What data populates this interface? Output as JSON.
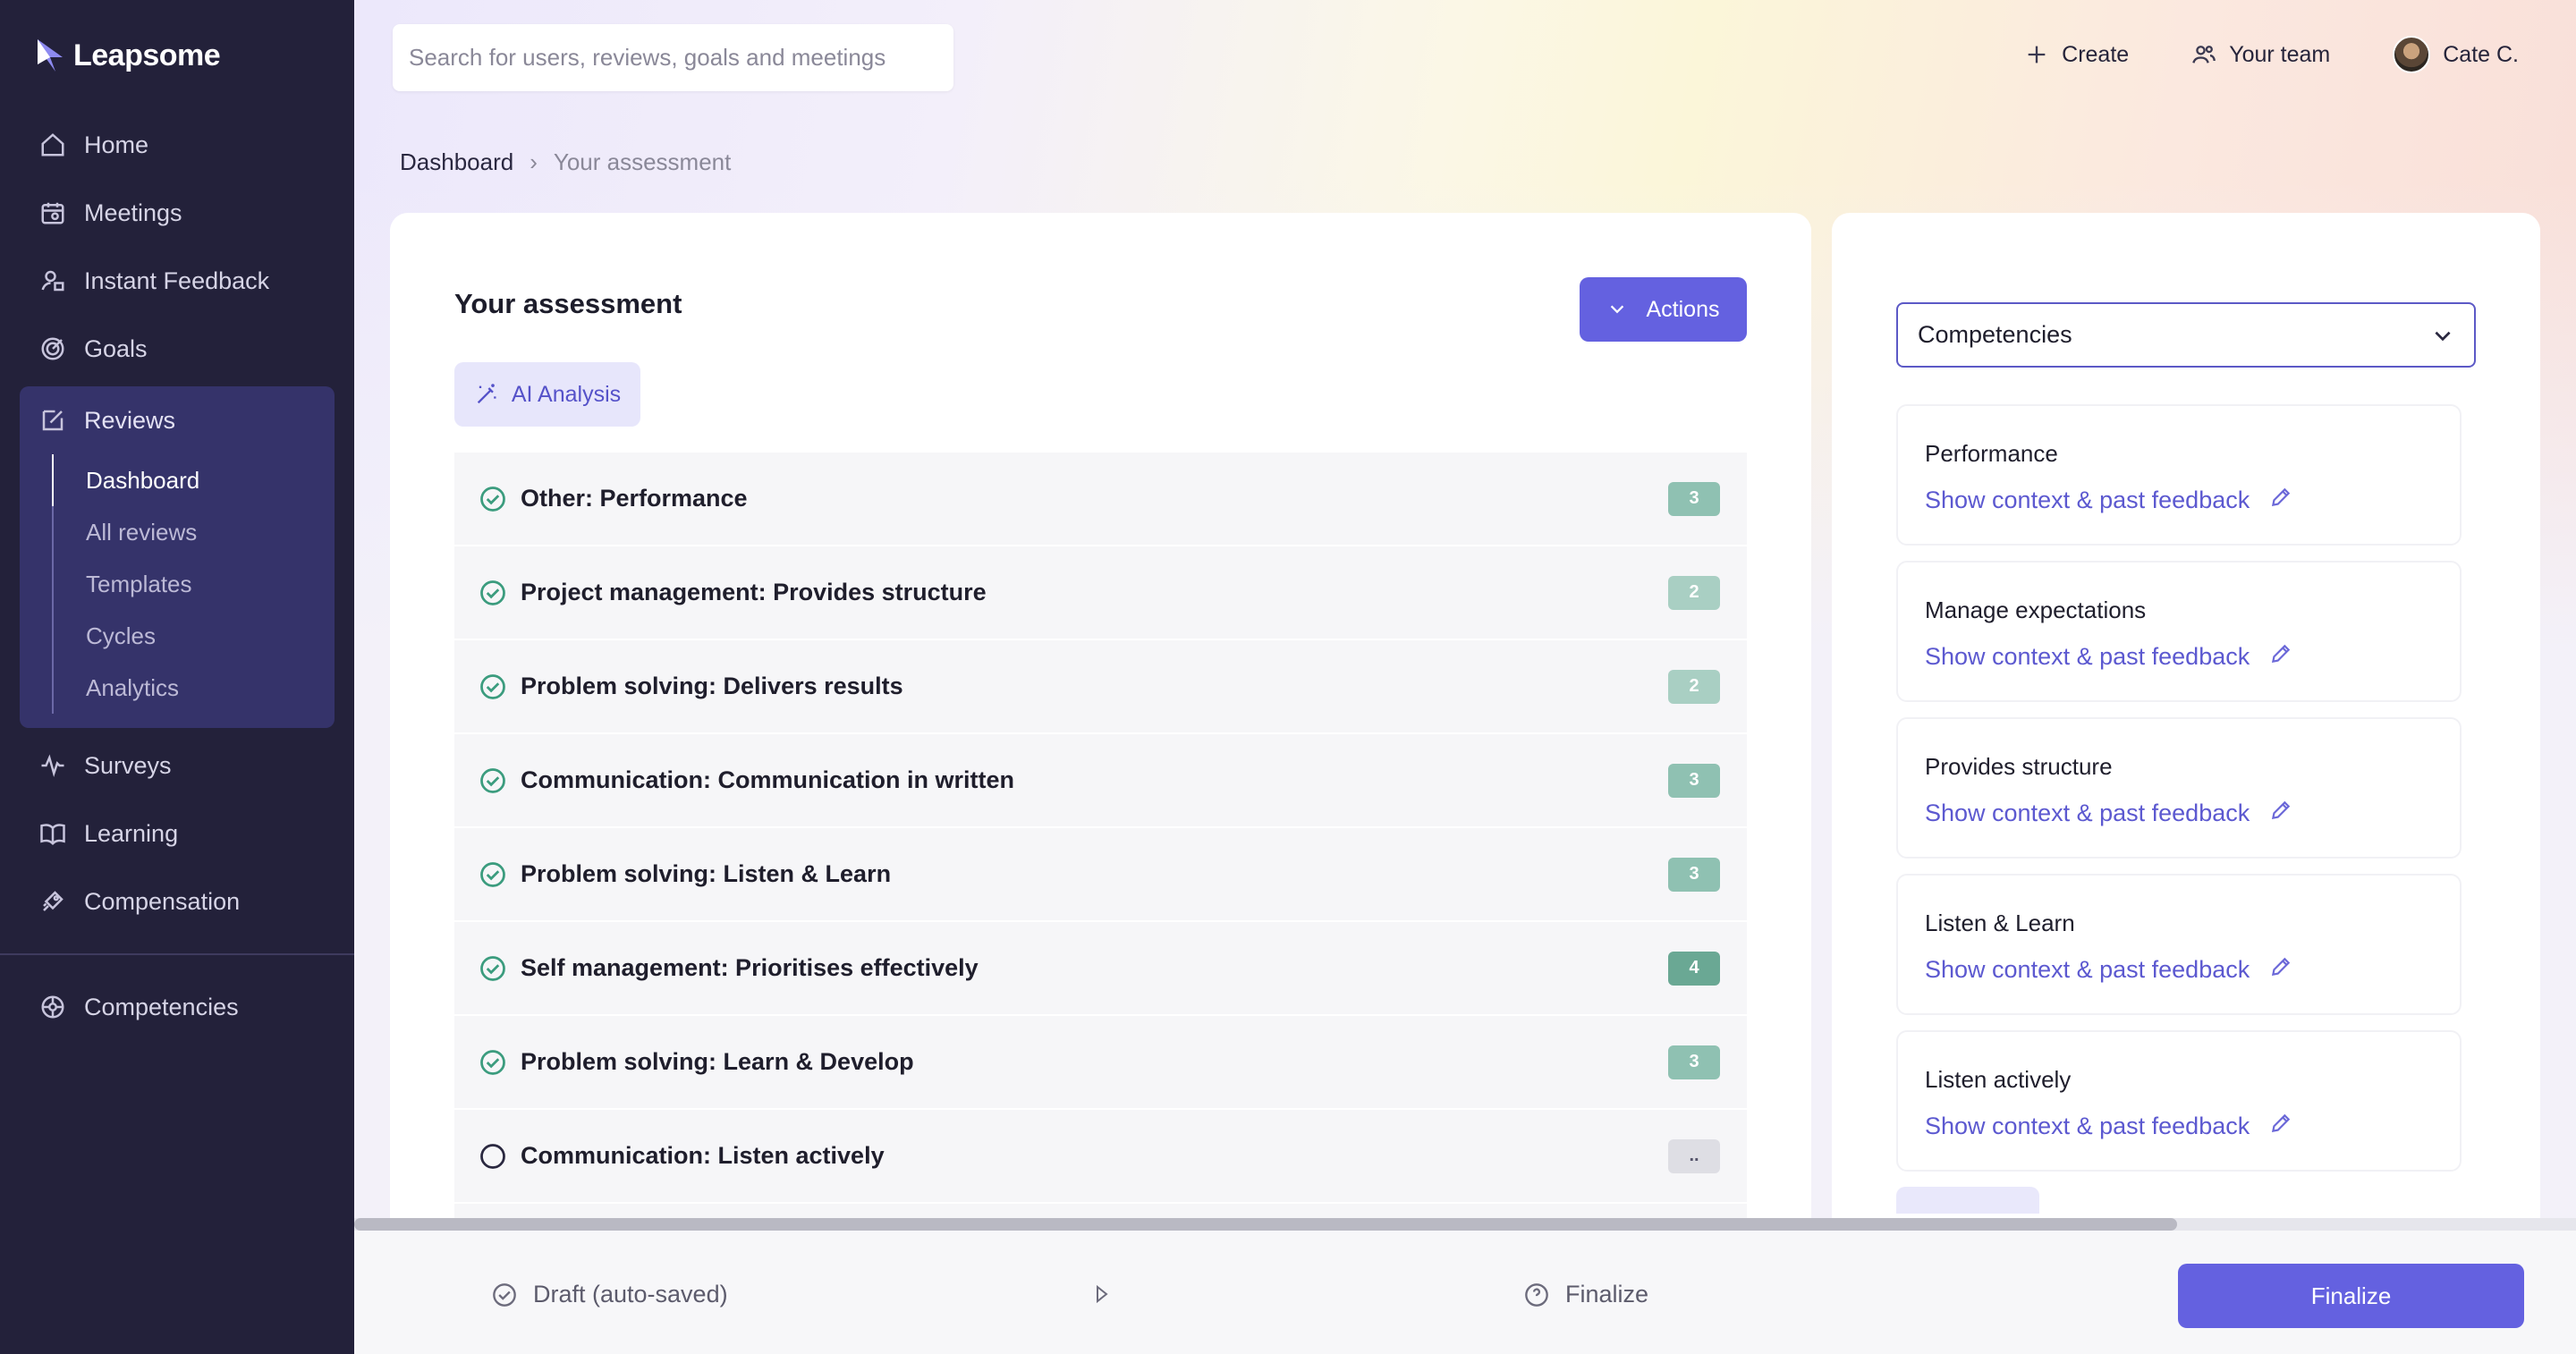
{
  "app": {
    "name": "Leapsome"
  },
  "sidebar": {
    "items": [
      {
        "label": "Home",
        "icon": "home-icon"
      },
      {
        "label": "Meetings",
        "icon": "meetings-icon"
      },
      {
        "label": "Instant Feedback",
        "icon": "feedback-icon"
      },
      {
        "label": "Goals",
        "icon": "goals-icon"
      }
    ],
    "reviews": {
      "label": "Reviews",
      "sub": [
        "Dashboard",
        "All reviews",
        "Templates",
        "Cycles",
        "Analytics"
      ],
      "active_sub": "Dashboard"
    },
    "items_after": [
      {
        "label": "Surveys",
        "icon": "surveys-icon"
      },
      {
        "label": "Learning",
        "icon": "learning-icon"
      },
      {
        "label": "Compensation",
        "icon": "compensation-icon"
      }
    ],
    "bottom": {
      "label": "Competencies",
      "icon": "competencies-icon"
    }
  },
  "header": {
    "search_placeholder": "Search for users, reviews, goals and meetings",
    "create_label": "Create",
    "team_label": "Your team",
    "user_name": "Cate C."
  },
  "breadcrumb": {
    "parent": "Dashboard",
    "current": "Your assessment"
  },
  "assessment": {
    "title": "Your assessment",
    "actions_label": "Actions",
    "ai_label": "AI Analysis",
    "rows": [
      {
        "label": "Other: Performance",
        "score": "3",
        "done": true
      },
      {
        "label": "Project management: Provides structure",
        "score": "2",
        "done": true
      },
      {
        "label": "Problem solving: Delivers results",
        "score": "2",
        "done": true
      },
      {
        "label": "Communication: Communication in written",
        "score": "3",
        "done": true
      },
      {
        "label": "Problem solving: Listen & Learn",
        "score": "3",
        "done": true
      },
      {
        "label": "Self management: Prioritises effectively",
        "score": "4",
        "done": true
      },
      {
        "label": "Problem solving: Learn & Develop",
        "score": "3",
        "done": true
      },
      {
        "label": "Communication: Listen actively",
        "score": "..",
        "done": false
      }
    ],
    "badge_colors": {
      "2": "#a9cfc3",
      "3": "#8fc1b2",
      "4": "#6aa894",
      "..": "#dedee4"
    },
    "check_color": "#3b9c7e"
  },
  "competencies": {
    "select_value": "Competencies",
    "link_label": "Show context & past feedback",
    "items": [
      "Performance",
      "Manage expectations",
      "Provides structure",
      "Listen & Learn",
      "Listen actively"
    ]
  },
  "footer": {
    "draft_label": "Draft (auto-saved)",
    "finalize_step_label": "Finalize",
    "finalize_button": "Finalize"
  },
  "colors": {
    "accent": "#6461e0",
    "sidebar": "#23213a",
    "sidebar_active": "#35336a"
  }
}
